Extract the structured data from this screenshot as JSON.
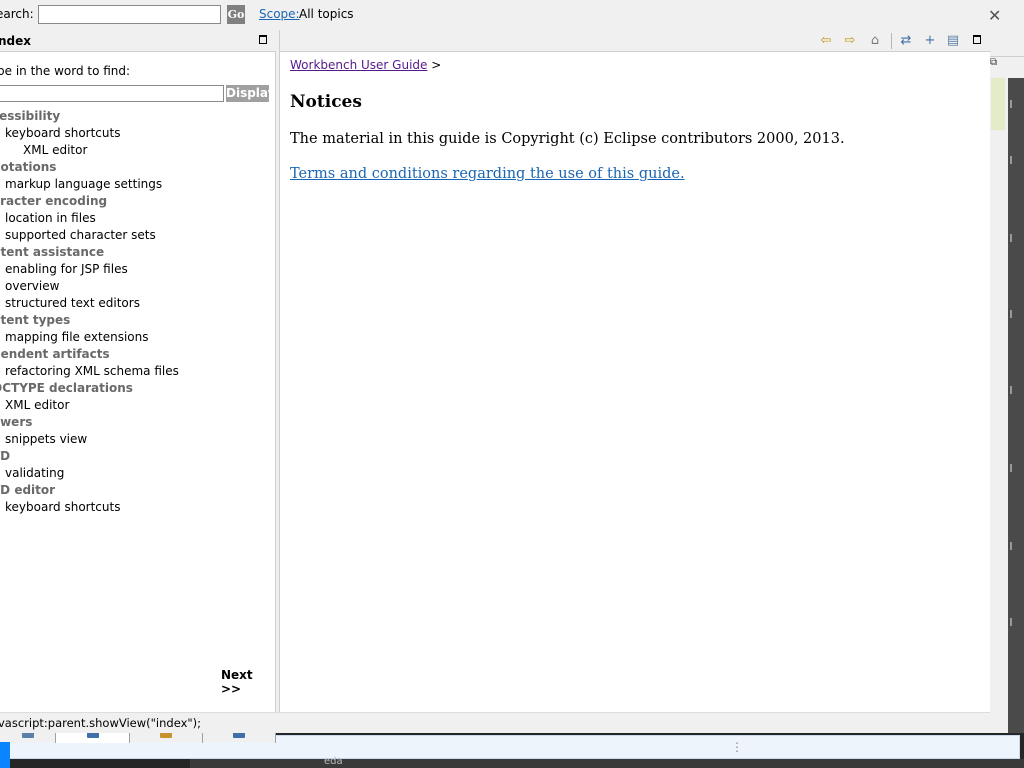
{
  "search": {
    "label": "earch:",
    "value": "",
    "go_label": "Go",
    "scope_link": "Scope:",
    "scope_value": "All topics"
  },
  "index": {
    "title": "ndex",
    "find_label": "pe in the word to find:",
    "find_value": "",
    "display_label": "Display",
    "next_label": "Next >>",
    "items": [
      {
        "label": "cessibility",
        "level": 0
      },
      {
        "label": "keyboard shortcuts",
        "level": 1
      },
      {
        "label": "XML editor",
        "level": 2
      },
      {
        "label": "notations",
        "level": 0
      },
      {
        "label": "markup language settings",
        "level": 1
      },
      {
        "label": "aracter encoding",
        "level": 0
      },
      {
        "label": "location in files",
        "level": 1
      },
      {
        "label": "supported character sets",
        "level": 1
      },
      {
        "label": "ntent assistance",
        "level": 0
      },
      {
        "label": "enabling for JSP files",
        "level": 1
      },
      {
        "label": "overview",
        "level": 1
      },
      {
        "label": "structured text editors",
        "level": 1
      },
      {
        "label": "ntent types",
        "level": 0
      },
      {
        "label": "mapping file extensions",
        "level": 1
      },
      {
        "label": "pendent artifacts",
        "level": 0
      },
      {
        "label": "refactoring XML schema files",
        "level": 1
      },
      {
        "label": "OCTYPE declarations",
        "level": 0
      },
      {
        "label": "XML editor",
        "level": 1
      },
      {
        "label": "awers",
        "level": 0
      },
      {
        "label": "snippets view",
        "level": 1
      },
      {
        "label": "TD",
        "level": 0
      },
      {
        "label": "validating",
        "level": 1
      },
      {
        "label": "TD editor",
        "level": 0
      },
      {
        "label": "keyboard shortcuts",
        "level": 1
      }
    ],
    "tabs": [
      {
        "icon": "contents-icon",
        "color": "#5b7fa8"
      },
      {
        "icon": "index-icon",
        "color": "#3f6fa8"
      },
      {
        "icon": "search-results-icon",
        "color": "#c7932f"
      },
      {
        "icon": "bookmarks-icon",
        "color": "#3f6fa8"
      }
    ]
  },
  "content": {
    "breadcrumb_link": "Workbench User Guide",
    "breadcrumb_sep": ">",
    "title": "Notices",
    "body": "The material in this guide is Copyright (c) Eclipse contributors 2000, 2013.",
    "link": "Terms and conditions regarding the use of this guide.",
    "toolbar": [
      {
        "name": "back-icon",
        "glyph": "⇦",
        "color": "#c49a1a"
      },
      {
        "name": "forward-icon",
        "glyph": "⇨",
        "color": "#c49a1a"
      },
      {
        "name": "home-icon",
        "glyph": "⌂",
        "color": "#7a7a7a"
      },
      {
        "name": "show-in-toc-icon",
        "glyph": "⇄",
        "color": "#3f6fa8"
      },
      {
        "name": "bookmark-document-icon",
        "glyph": "+",
        "color": "#3f6fa8"
      },
      {
        "name": "print-icon",
        "glyph": "▤",
        "color": "#5b7fa8"
      }
    ]
  },
  "status": {
    "text": "vascript:parent.showView(\"index\");"
  },
  "background": {
    "taskbar_text": "eda"
  }
}
